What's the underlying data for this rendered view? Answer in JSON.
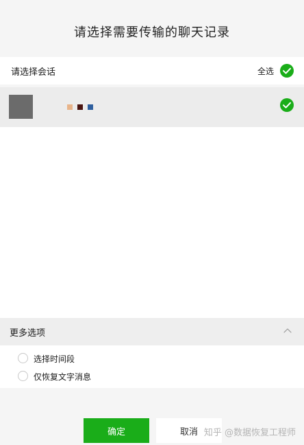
{
  "dialog": {
    "title": "请选择需要传输的聊天记录"
  },
  "session_section": {
    "label": "请选择会话",
    "select_all_label": "全选",
    "select_all_checked": true
  },
  "contacts": [
    {
      "checked": true,
      "swatch_colors": [
        "#e8b48a",
        "#4a1410",
        "#2f5f9e"
      ]
    }
  ],
  "more_options": {
    "label": "更多选项",
    "expanded": true,
    "options": [
      {
        "label": "选择时间段",
        "checked": false
      },
      {
        "label": "仅恢复文字消息",
        "checked": false
      }
    ]
  },
  "actions": {
    "confirm_label": "确定",
    "cancel_label": "取消"
  },
  "watermark": {
    "text": "知乎 @数据恢复工程师"
  },
  "colors": {
    "accent_green": "#1aad19",
    "avatar_gray": "#6b6b6b",
    "background": "#f5f5f5"
  }
}
